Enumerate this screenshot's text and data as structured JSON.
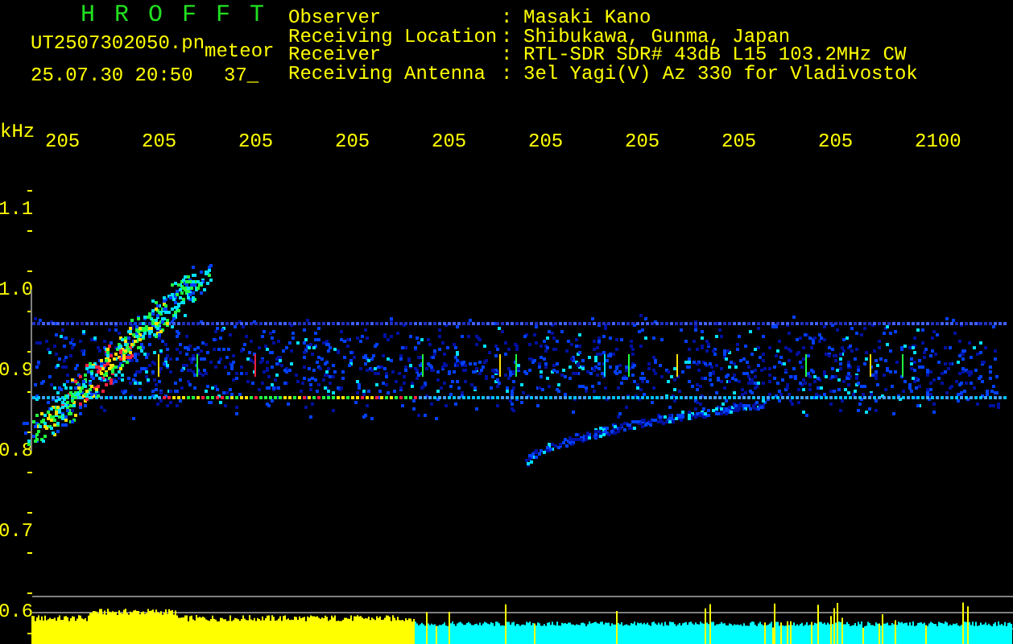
{
  "app": {
    "title": "HROFFT"
  },
  "file": {
    "name": "UT2507302050.pn",
    "tag": "meteor",
    "timestamp": "25.07.30 20:50",
    "count": "37_"
  },
  "station": [
    {
      "label": "Observer",
      "separator": ":",
      "value": "Masaki Kano"
    },
    {
      "label": "Receiving Location",
      "separator": ":",
      "value": "Shibukawa, Gunma, Japan"
    },
    {
      "label": "Receiver",
      "separator": ":",
      "value": "RTL-SDR SDR# 43dB L15 103.2MHz CW"
    },
    {
      "label": "Receiving Antenna",
      "separator": ":",
      "value": "3el Yagi(V) Az 330 for Vladivostok"
    }
  ],
  "chart": {
    "unit": "kHz",
    "x_labels": [
      "205",
      "205",
      "205",
      "205",
      "205",
      "205",
      "205",
      "205",
      "205",
      "2100"
    ],
    "y_labels": [
      "1.1",
      "1.0",
      "0.9",
      "0.8",
      "0.7",
      "0.6"
    ]
  }
}
